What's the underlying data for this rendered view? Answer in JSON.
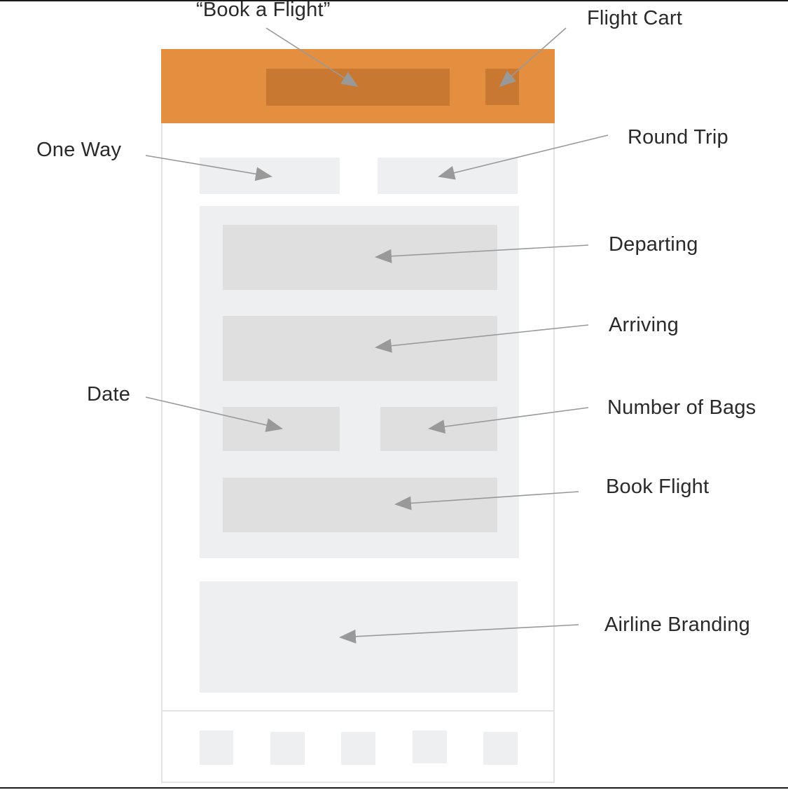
{
  "labels": {
    "book_a_flight": "“Book a Flight”",
    "flight_cart": "Flight Cart",
    "one_way": "One Way",
    "round_trip": "Round Trip",
    "departing": "Departing",
    "arriving": "Arriving",
    "date": "Date",
    "number_of_bags": "Number of Bags",
    "book_flight": "Book Flight",
    "airline_branding": "Airline Branding"
  },
  "colors": {
    "header": "#e38f3f",
    "header_block": "#c97832",
    "panel": "#eeeff0",
    "field": "#dfdfe0",
    "arrow": "#999999",
    "text": "#2a2a2a"
  }
}
